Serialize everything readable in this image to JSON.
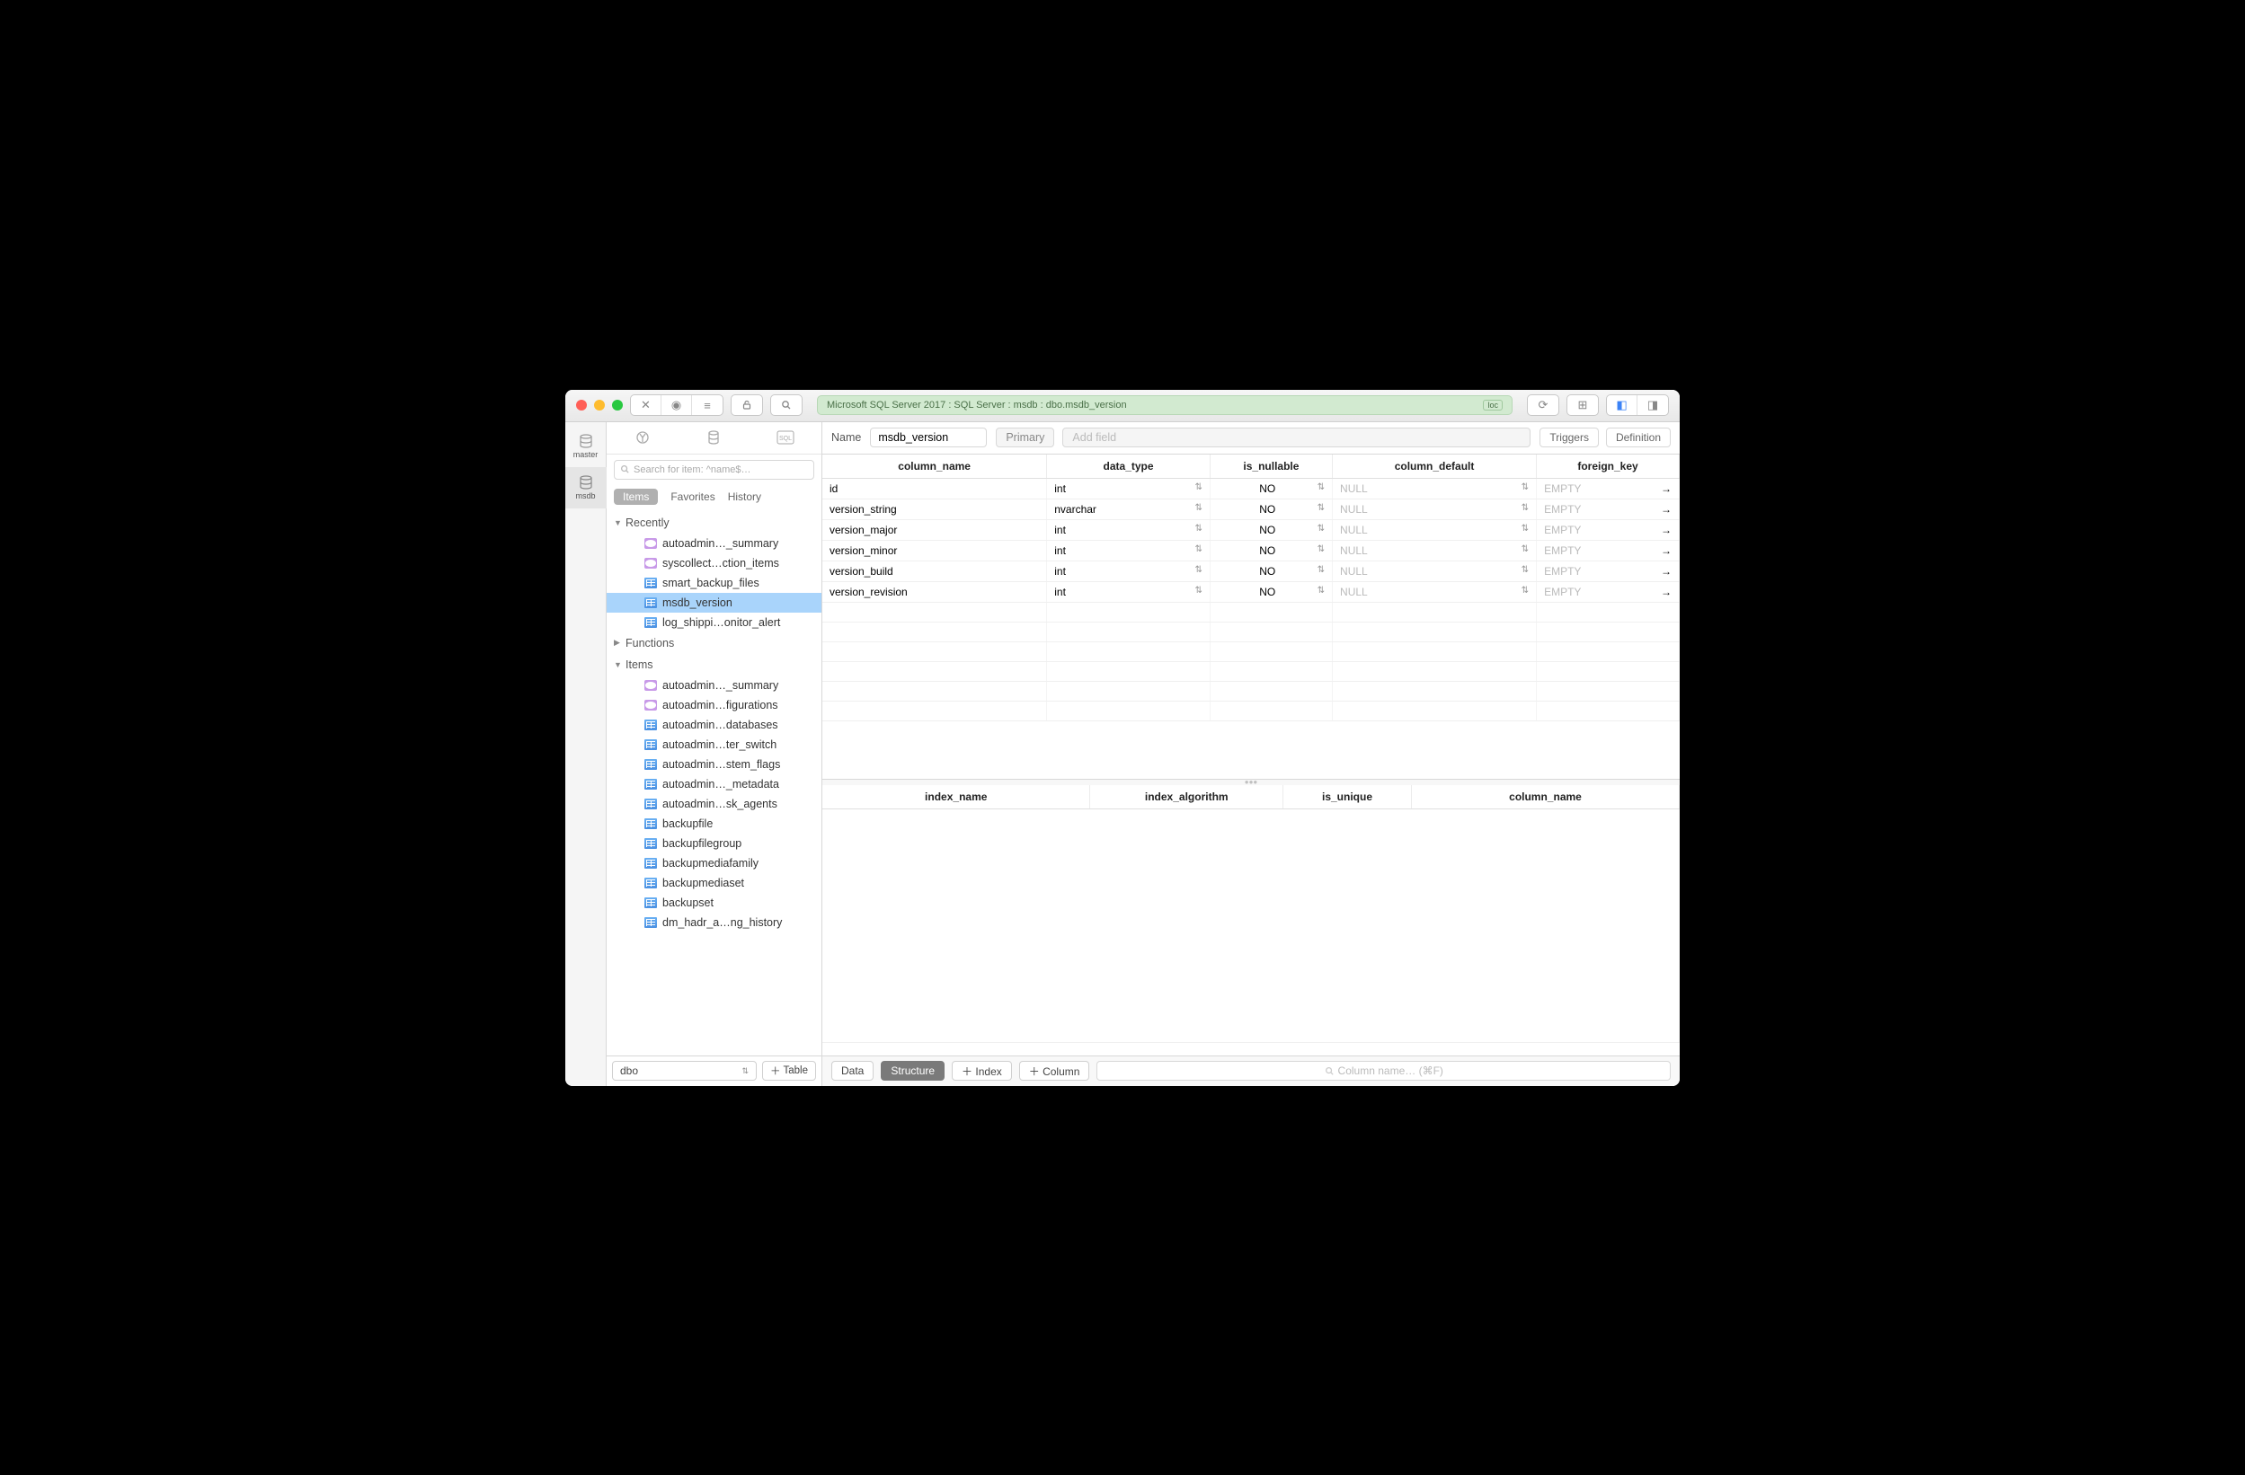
{
  "breadcrumb": "Microsoft SQL Server 2017 : SQL Server : msdb : dbo.msdb_version",
  "loc_badge": "loc",
  "db_tabs": [
    {
      "label": "master",
      "active": false
    },
    {
      "label": "msdb",
      "active": true
    }
  ],
  "sidebar": {
    "search_placeholder": "Search for item: ^name$…",
    "segments": {
      "items": "Items",
      "favorites": "Favorites",
      "history": "History"
    },
    "groups": [
      {
        "title": "Recently",
        "expanded": true,
        "items": [
          {
            "icon": "view",
            "label": "autoadmin…_summary"
          },
          {
            "icon": "view",
            "label": "syscollect…ction_items"
          },
          {
            "icon": "table",
            "label": "smart_backup_files"
          },
          {
            "icon": "table",
            "label": "msdb_version",
            "selected": true
          },
          {
            "icon": "table",
            "label": "log_shippi…onitor_alert"
          }
        ]
      },
      {
        "title": "Functions",
        "expanded": false,
        "items": []
      },
      {
        "title": "Items",
        "expanded": true,
        "items": [
          {
            "icon": "view",
            "label": "autoadmin…_summary"
          },
          {
            "icon": "view",
            "label": "autoadmin…figurations"
          },
          {
            "icon": "table",
            "label": "autoadmin…databases"
          },
          {
            "icon": "table",
            "label": "autoadmin…ter_switch"
          },
          {
            "icon": "table",
            "label": "autoadmin…stem_flags"
          },
          {
            "icon": "table",
            "label": "autoadmin…_metadata"
          },
          {
            "icon": "table",
            "label": "autoadmin…sk_agents"
          },
          {
            "icon": "table",
            "label": "backupfile"
          },
          {
            "icon": "table",
            "label": "backupfilegroup"
          },
          {
            "icon": "table",
            "label": "backupmediafamily"
          },
          {
            "icon": "table",
            "label": "backupmediaset"
          },
          {
            "icon": "table",
            "label": "backupset"
          },
          {
            "icon": "table",
            "label": "dm_hadr_a…ng_history"
          }
        ]
      }
    ],
    "schema": "dbo",
    "add_table": "Table"
  },
  "main": {
    "name_label": "Name",
    "table_name": "msdb_version",
    "primary_label": "Primary",
    "add_field_placeholder": "Add field",
    "triggers_btn": "Triggers",
    "definition_btn": "Definition",
    "headers": {
      "column_name": "column_name",
      "data_type": "data_type",
      "is_nullable": "is_nullable",
      "column_default": "column_default",
      "foreign_key": "foreign_key"
    },
    "rows": [
      {
        "name": "id",
        "type": "int",
        "nullable": "NO",
        "default": "NULL",
        "fk": "EMPTY"
      },
      {
        "name": "version_string",
        "type": "nvarchar",
        "nullable": "NO",
        "default": "NULL",
        "fk": "EMPTY"
      },
      {
        "name": "version_major",
        "type": "int",
        "nullable": "NO",
        "default": "NULL",
        "fk": "EMPTY"
      },
      {
        "name": "version_minor",
        "type": "int",
        "nullable": "NO",
        "default": "NULL",
        "fk": "EMPTY"
      },
      {
        "name": "version_build",
        "type": "int",
        "nullable": "NO",
        "default": "NULL",
        "fk": "EMPTY"
      },
      {
        "name": "version_revision",
        "type": "int",
        "nullable": "NO",
        "default": "NULL",
        "fk": "EMPTY"
      }
    ],
    "idx_headers": {
      "index_name": "index_name",
      "index_algorithm": "index_algorithm",
      "is_unique": "is_unique",
      "column_name": "column_name"
    }
  },
  "footer": {
    "data": "Data",
    "structure": "Structure",
    "index": "Index",
    "column": "Column",
    "filter_placeholder": "Column name… (⌘F)"
  }
}
